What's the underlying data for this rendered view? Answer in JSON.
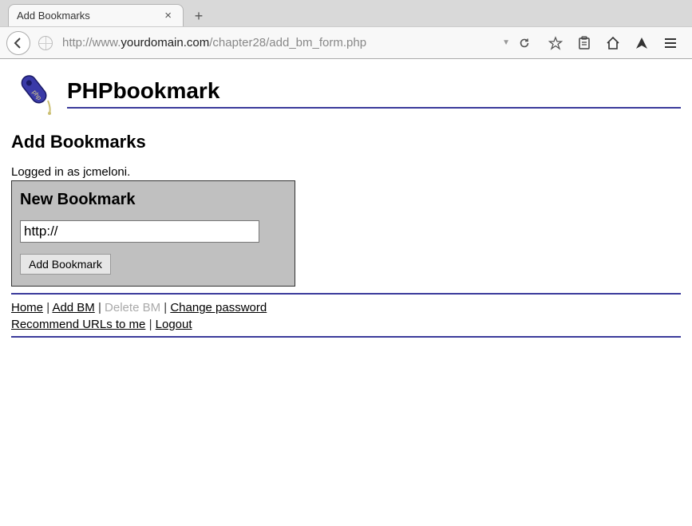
{
  "chrome": {
    "tab_title": "Add Bookmarks",
    "url_prefix": "http://www.",
    "url_domain": "yourdomain.com",
    "url_path": "/chapter28/add_bm_form.php"
  },
  "page": {
    "brand": "PHPbookmark",
    "heading": "Add Bookmarks",
    "logged_in": "Logged in as jcmeloni.",
    "form_heading": "New Bookmark",
    "url_value": "http://",
    "submit_label": "Add Bookmark"
  },
  "nav": {
    "home": "Home",
    "add_bm": "Add BM",
    "delete_bm": "Delete BM",
    "change_pw": "Change password",
    "recommend": "Recommend URLs to me",
    "logout": "Logout",
    "sep": " | "
  }
}
